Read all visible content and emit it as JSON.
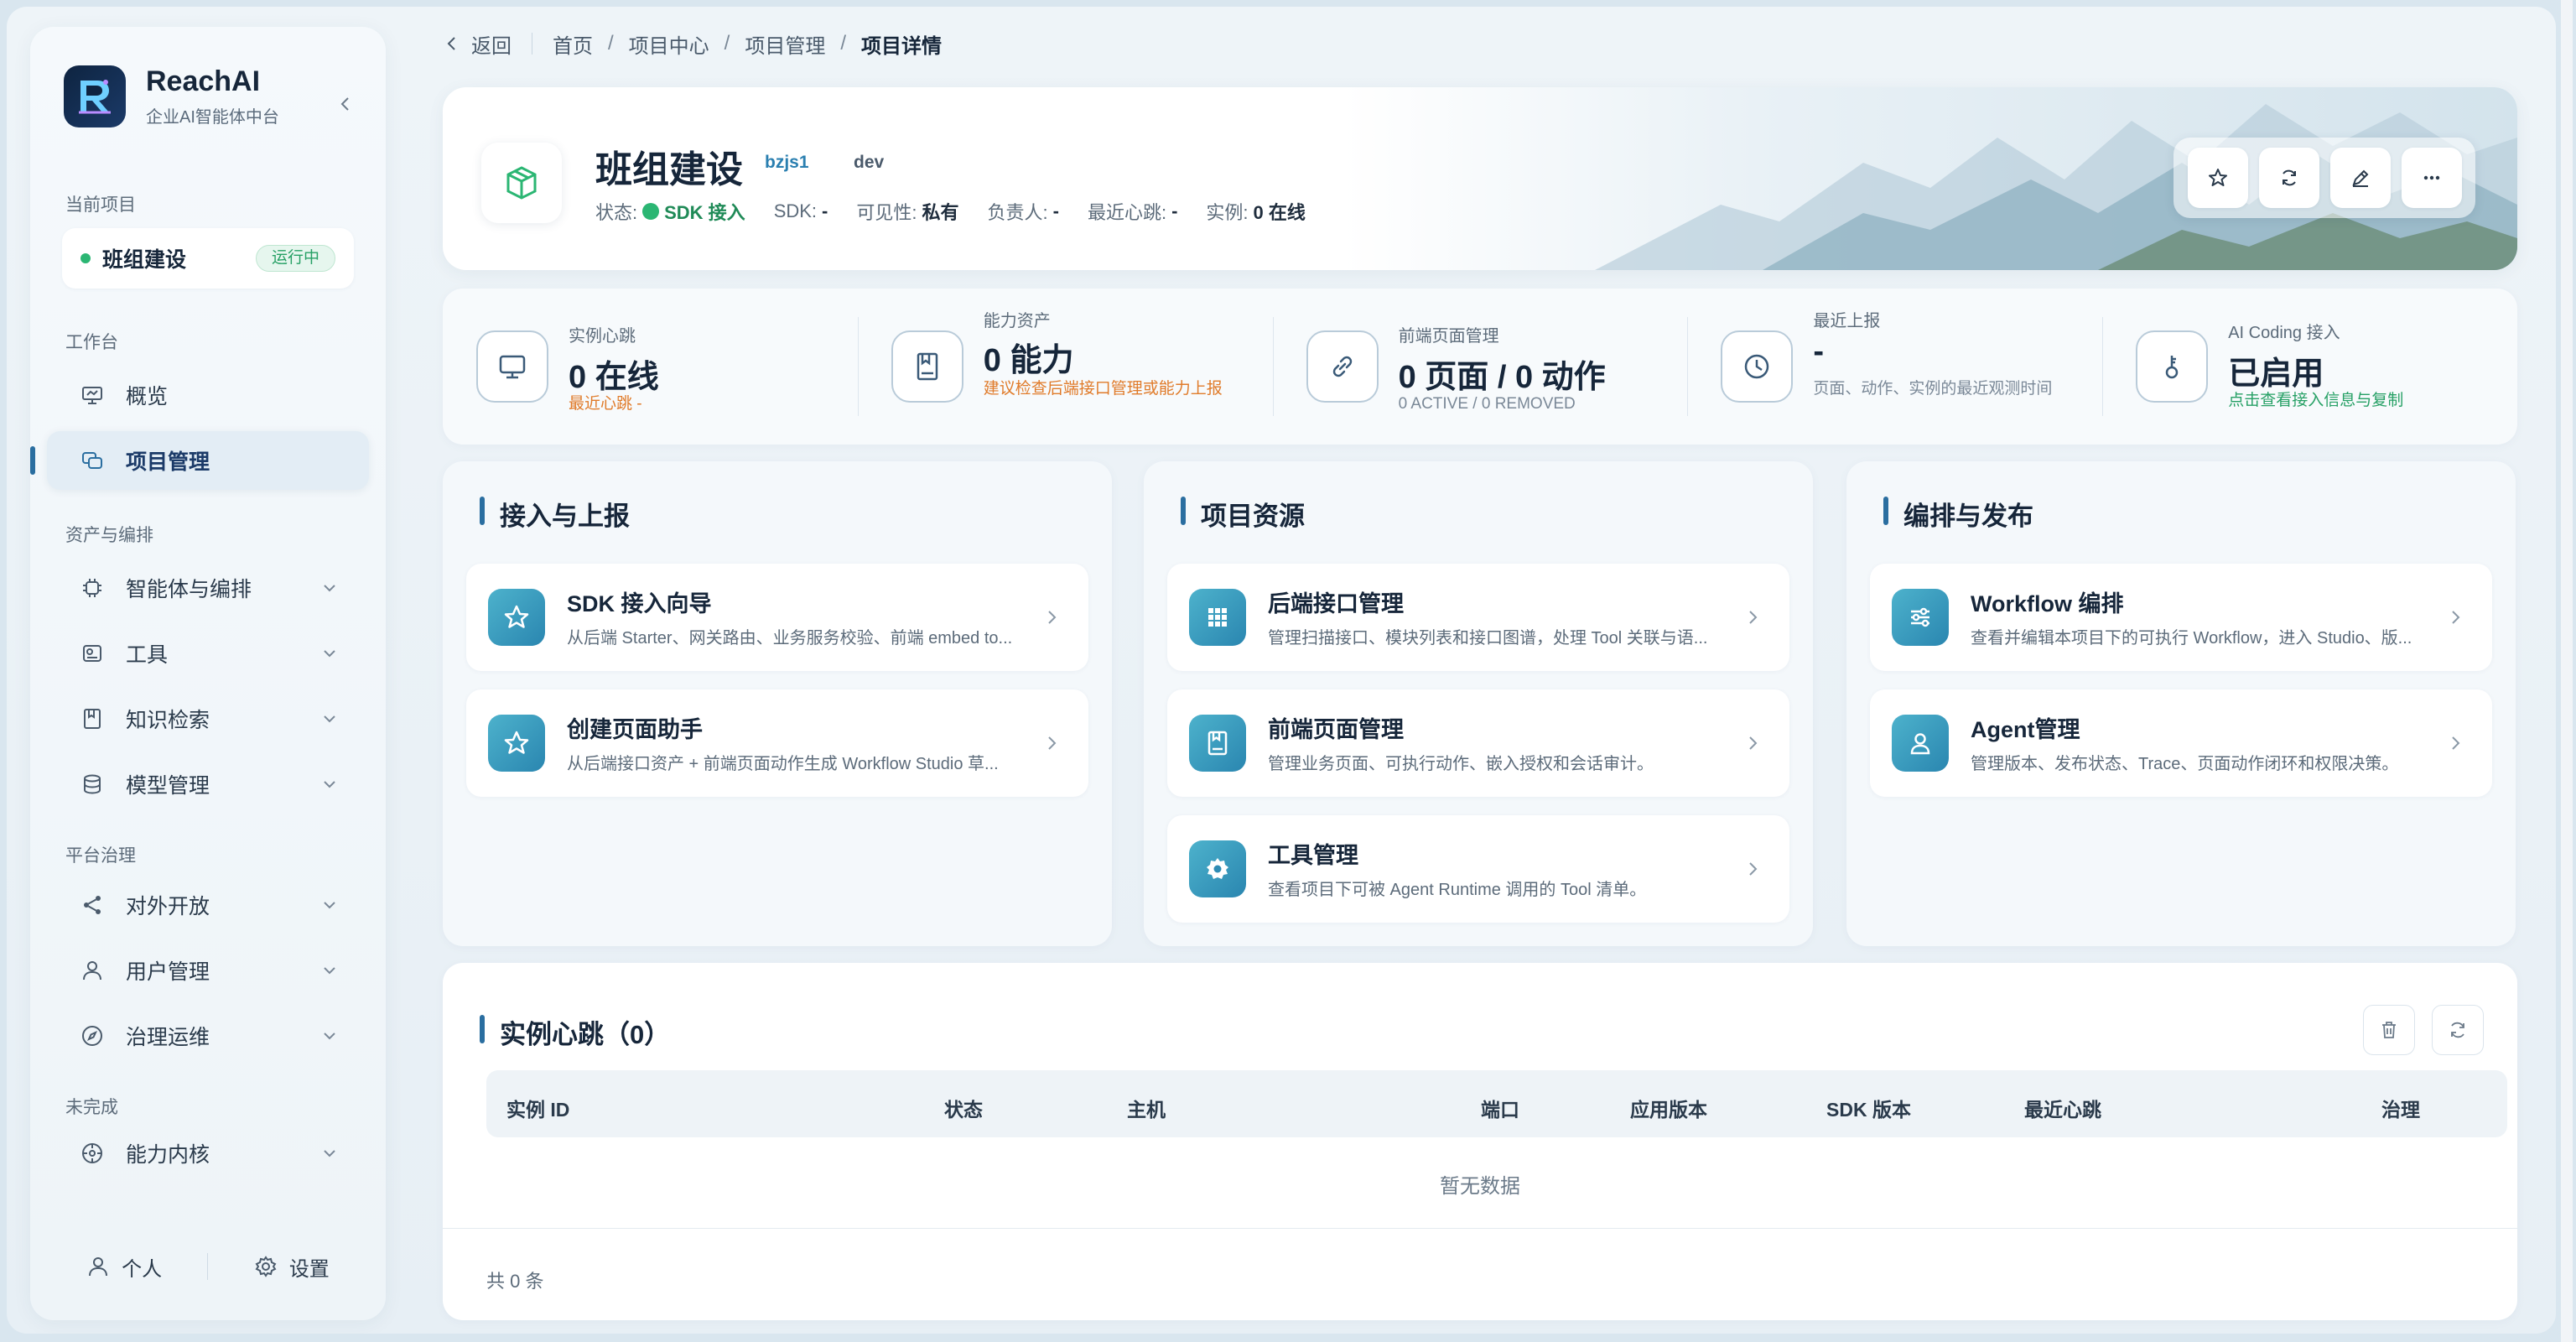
{
  "brand": {
    "name": "ReachAI",
    "subtitle": "企业AI智能体中台"
  },
  "sidebar": {
    "current_project_label": "当前项目",
    "current_project_name": "班组建设",
    "current_project_status": "运行中",
    "sections": {
      "workbench": "工作台",
      "assets": "资产与编排",
      "governance": "平台治理",
      "unfinished": "未完成"
    },
    "items": [
      {
        "label": "概览"
      },
      {
        "label": "项目管理"
      },
      {
        "label": "智能体与编排"
      },
      {
        "label": "工具"
      },
      {
        "label": "知识检索"
      },
      {
        "label": "模型管理"
      },
      {
        "label": "对外开放"
      },
      {
        "label": "用户管理"
      },
      {
        "label": "治理运维"
      },
      {
        "label": "能力内核"
      }
    ],
    "footer": {
      "personal": "个人",
      "settings": "设置"
    }
  },
  "topbar": {
    "back": "返回",
    "breadcrumb": [
      "首页",
      "项目中心",
      "项目管理",
      "项目详情"
    ],
    "sep": "/"
  },
  "hero": {
    "title": "班组建设",
    "tag_code": "bzjs1",
    "tag_env": "dev",
    "meta": {
      "status_k": "状态:",
      "status_v": "SDK 接入",
      "sdk_k": "SDK:",
      "sdk_v": "-",
      "vis_k": "可见性:",
      "vis_v": "私有",
      "owner_k": "负责人:",
      "owner_v": "-",
      "beat_k": "最近心跳:",
      "beat_v": "-",
      "inst_k": "实例:",
      "inst_v": "0 在线"
    }
  },
  "stats": [
    {
      "label": "实例心跳",
      "value": "0 在线",
      "sub": "最近心跳 -",
      "sub_color": "#e07b2a"
    },
    {
      "label": "能力资产",
      "value": "0 能力",
      "sub": "建议检查后端接口管理或能力上报",
      "sub_color": "#e07b2a"
    },
    {
      "label": "前端页面管理",
      "value": "0 页面 / 0 动作",
      "sub": "0 ACTIVE / 0 REMOVED",
      "sub_color": "#7a8897"
    },
    {
      "label": "最近上报",
      "value": "-",
      "sub": "页面、动作、实例的最近观测时间",
      "sub_color": "#7a8897"
    },
    {
      "label": "AI Coding 接入",
      "value": "已启用",
      "sub": "点击查看接入信息与复制",
      "sub_color": "#26a065"
    }
  ],
  "panels": [
    {
      "title": "接入与上报",
      "cards": [
        {
          "title": "SDK 接入向导",
          "desc": "从后端 Starter、网关路由、业务服务校验、前端 embed to..."
        },
        {
          "title": "创建页面助手",
          "desc": "从后端接口资产 + 前端页面动作生成 Workflow Studio 草..."
        }
      ]
    },
    {
      "title": "项目资源",
      "cards": [
        {
          "title": "后端接口管理",
          "desc": "管理扫描接口、模块列表和接口图谱，处理 Tool 关联与语..."
        },
        {
          "title": "前端页面管理",
          "desc": "管理业务页面、可执行动作、嵌入授权和会话审计。"
        },
        {
          "title": "工具管理",
          "desc": "查看项目下可被 Agent Runtime 调用的 Tool 清单。"
        }
      ]
    },
    {
      "title": "编排与发布",
      "cards": [
        {
          "title": "Workflow 编排",
          "desc": "查看并编辑本项目下的可执行 Workflow，进入 Studio、版..."
        },
        {
          "title": "Agent管理",
          "desc": "管理版本、发布状态、Trace、页面动作闭环和权限决策。"
        }
      ]
    }
  ],
  "instances": {
    "title": "实例心跳（0）",
    "columns": [
      "实例 ID",
      "状态",
      "主机",
      "端口",
      "应用版本",
      "SDK 版本",
      "最近心跳",
      "治理"
    ],
    "empty": "暂无数据",
    "total": "共 0 条"
  },
  "colors": {
    "accent": "#2a6ea0",
    "success": "#2bb673",
    "warn": "#e07b2a"
  }
}
